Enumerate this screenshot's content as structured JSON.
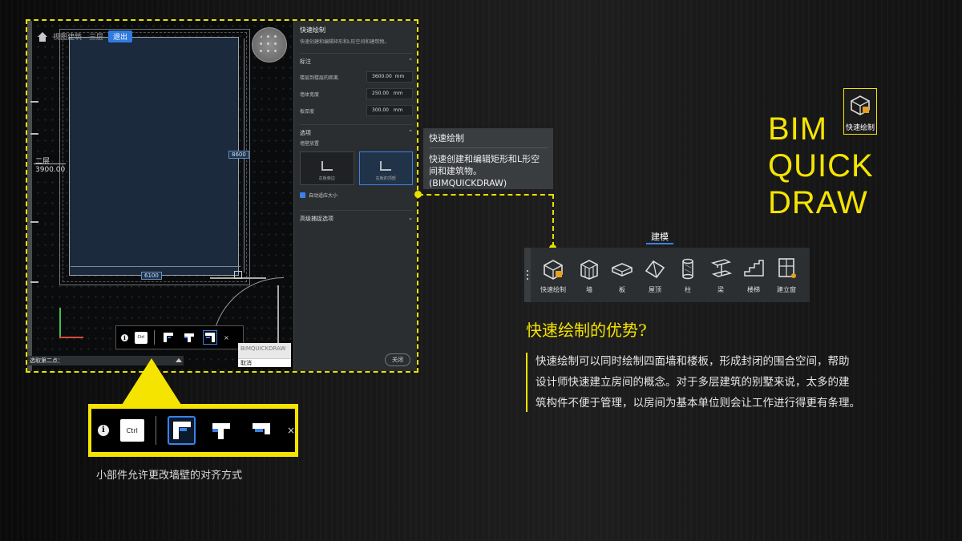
{
  "screenshot": {
    "breadcrumb": "视图建筑 - 三层",
    "exit_label": "退出",
    "level": {
      "name": "二层",
      "elevation": "3900.00"
    },
    "dims": {
      "vertical": "8600",
      "horizontal": "6100"
    },
    "prompt": "选取第二点：",
    "tooltip_small": {
      "command": "BIMQUICKDRAW",
      "cancel": "取消"
    },
    "panel": {
      "title": "快速绘制",
      "description": "快速创建和编辑矩形和L形空间和建筑物。",
      "sections": {
        "annotation": "标注",
        "options": "选项",
        "advanced": "高级捕捉选项"
      },
      "fields": [
        {
          "label": "楼层到楼层的距离",
          "value": "3600.00",
          "unit": "mm"
        },
        {
          "label": "墙体宽度",
          "value": "250.00",
          "unit": "mm"
        },
        {
          "label": "板厚度",
          "value": "300.00",
          "unit": "mm"
        }
      ],
      "wall_position_label": "墙壁放置",
      "options": [
        {
          "label": "在板旁边",
          "selected": false
        },
        {
          "label": "在板的顶部",
          "selected": true
        }
      ],
      "auto_size": "自动适应大小",
      "close": "关闭"
    }
  },
  "tooltip": {
    "title": "快速绘制",
    "description": "快速创建和编辑矩形和L形空间和建筑物。",
    "command": "(BIMQUICKDRAW)"
  },
  "ribbon": {
    "tab": "建模",
    "tools": [
      {
        "label": "快速绘制",
        "icon": "quick-draw-icon"
      },
      {
        "label": "墙",
        "icon": "wall-icon"
      },
      {
        "label": "板",
        "icon": "slab-icon"
      },
      {
        "label": "屋顶",
        "icon": "roof-icon"
      },
      {
        "label": "柱",
        "icon": "column-icon"
      },
      {
        "label": "梁",
        "icon": "beam-icon"
      },
      {
        "label": "楼梯",
        "icon": "stair-icon"
      },
      {
        "label": "建立窗",
        "icon": "window-icon"
      }
    ]
  },
  "title": {
    "line1": "BIM",
    "line2": "QUICK",
    "line3": "DRAW",
    "icon_label": "快速绘制"
  },
  "advantages": {
    "heading": "快速绘制的优势?",
    "lines": [
      "快速绘制可以同时绘制四面墙和楼板，形成封闭的围合空间，帮助",
      "设计师快速建立房间的概念。对于多层建筑的别墅来说，太多的建",
      "筑构件不便于管理，以房间为基本单位则会让工作进行得更有条理。"
    ]
  },
  "widget": {
    "ctrl_label": "Ctrl",
    "caption": "小部件允许更改墙壁的对齐方式"
  },
  "colors": {
    "accent": "#f5e400",
    "highlight": "#3a82e8"
  }
}
